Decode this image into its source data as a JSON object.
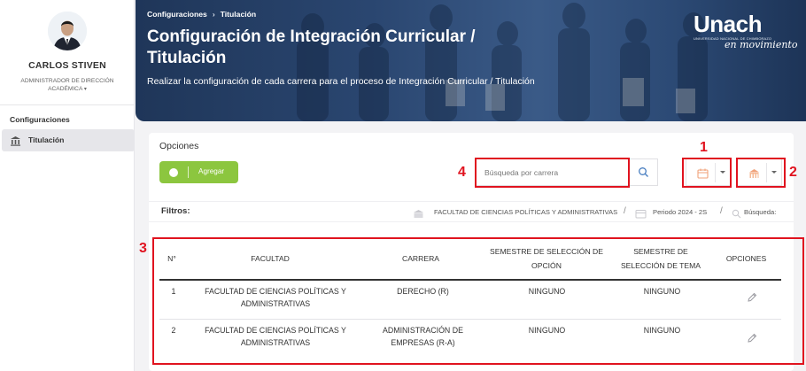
{
  "sidebar": {
    "user_name": "CARLOS STIVEN",
    "user_role": "ADMINISTRADOR DE DIRECCIÓN ACADÉMICA",
    "role_caret": "▾",
    "section_title": "Configuraciones",
    "items": [
      {
        "label": "Titulación",
        "icon": "building-icon"
      }
    ]
  },
  "banner": {
    "breadcrumb": [
      "Configuraciones",
      "Titulación"
    ],
    "breadcrumb_sep": "›",
    "title": "Configuración de Integración Curricular / Titulación",
    "subtitle": "Realizar la configuración de cada carrera para el proceso de Integración Curricular / Titulación",
    "logo_word": "Unach",
    "logo_institution": "UNIVERSIDAD NACIONAL DE CHIMBORAZO",
    "logo_slogan": "en movimiento"
  },
  "options": {
    "title": "Opciones",
    "add_label": "Agregar",
    "search_placeholder": "Búsqueda por carrera",
    "period_dropdown_icon": "calendar-icon",
    "faculty_dropdown_icon": "building-icon"
  },
  "filters": {
    "label": "Filtros:",
    "faculty": "FACULTAD DE CIENCIAS POLÍTICAS Y ADMINISTRATIVAS",
    "period": "Periodo 2024 - 2S",
    "search": "Búsqueda:",
    "separator": "/"
  },
  "table": {
    "headers": [
      "N°",
      "FACULTAD",
      "CARRERA",
      "SEMESTRE DE SELECCIÓN DE OPCIÓN",
      "SEMESTRE DE SELECCIÓN DE TEMA",
      "OPCIONES"
    ],
    "rows": [
      {
        "n": "1",
        "facultad": "FACULTAD DE CIENCIAS POLÍTICAS Y ADMINISTRATIVAS",
        "carrera": "DERECHO (R)",
        "sem_opcion": "NINGUNO",
        "sem_tema": "NINGUNO"
      },
      {
        "n": "2",
        "facultad": "FACULTAD DE CIENCIAS POLÍTICAS Y ADMINISTRATIVAS",
        "carrera": "ADMINISTRACIÓN DE EMPRESAS (R-A)",
        "sem_opcion": "NINGUNO",
        "sem_tema": "NINGUNO"
      }
    ]
  },
  "annotations": [
    "1",
    "2",
    "3",
    "4"
  ],
  "colors": {
    "accent_green": "#8cc63f",
    "banner_blue": "#2a4670",
    "annotation_red": "#e0131f",
    "icon_orange": "#f0a27a"
  }
}
